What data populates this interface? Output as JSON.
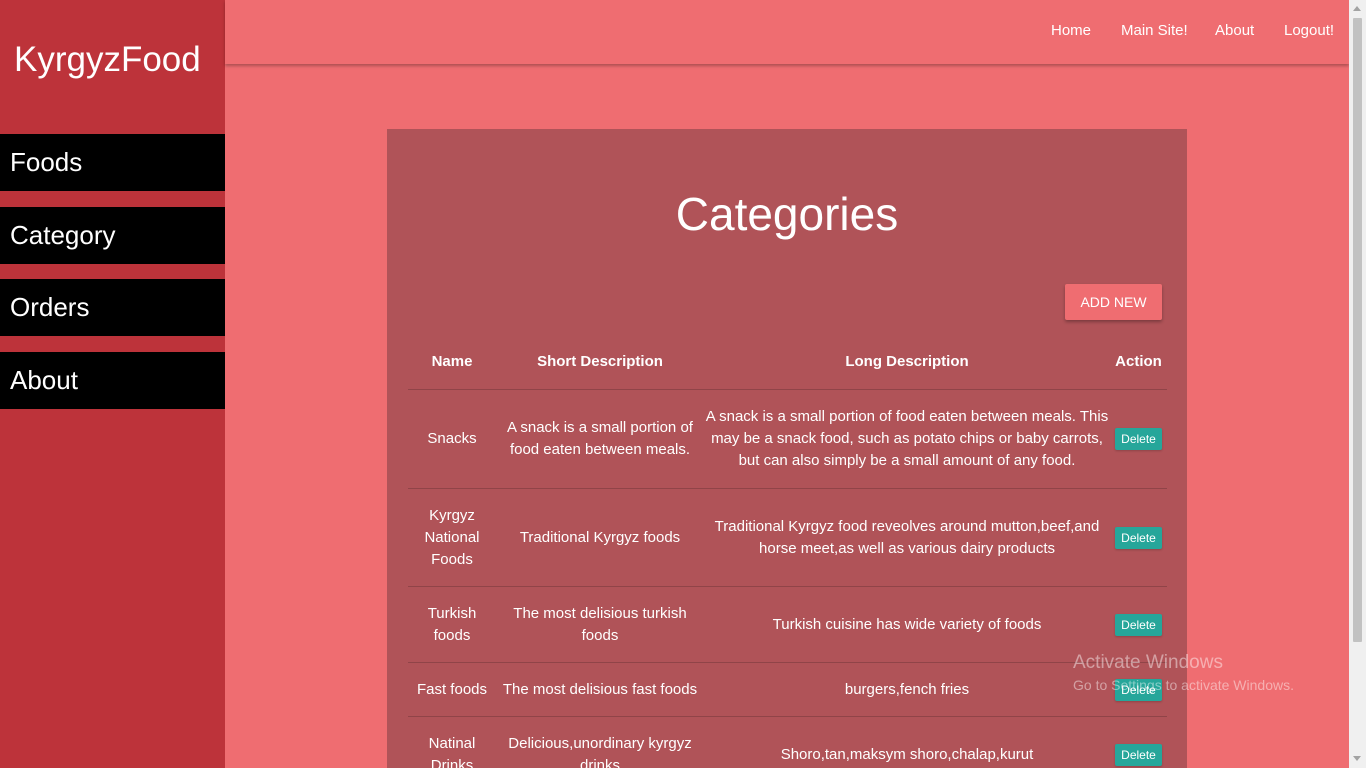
{
  "sidebar": {
    "brand": "KyrgyzFood",
    "items": [
      {
        "label": "Foods"
      },
      {
        "label": "Category"
      },
      {
        "label": "Orders"
      },
      {
        "label": "About"
      }
    ]
  },
  "topnav": {
    "links": [
      {
        "label": "Home"
      },
      {
        "label": "Main Site!"
      },
      {
        "label": "About"
      },
      {
        "label": "Logout!"
      }
    ]
  },
  "main": {
    "title": "Categories",
    "add_button": "ADD NEW",
    "table": {
      "headers": [
        "Name",
        "Short Description",
        "Long Description",
        "Action"
      ],
      "rows": [
        {
          "name": "Snacks",
          "short": "A snack is a small portion of food eaten between meals.",
          "long": "A snack is a small portion of food eaten between meals. This may be a snack food, such as potato chips or baby carrots, but can also simply be a small amount of any food.",
          "action": "Delete"
        },
        {
          "name": "Kyrgyz National Foods",
          "short": "Traditional Kyrgyz foods",
          "long": "Traditional Kyrgyz food reveolves around mutton,beef,and horse meet,as well as various dairy products",
          "action": "Delete"
        },
        {
          "name": "Turkish foods",
          "short": "The most delisious turkish foods",
          "long": "Turkish cuisine has wide variety of foods",
          "action": "Delete"
        },
        {
          "name": "Fast foods",
          "short": "The most delisious fast foods",
          "long": "burgers,fench fries",
          "action": "Delete"
        },
        {
          "name": "Natinal Drinks",
          "short": "Delicious,unordinary kyrgyz drinks",
          "long": "Shoro,tan,maksym shoro,chalap,kurut",
          "action": "Delete"
        }
      ]
    }
  },
  "watermark": {
    "title": "Activate Windows",
    "subtitle": "Go to Settings to activate Windows."
  },
  "colors": {
    "page_bg": "#ef6d71",
    "sidebar_bg": "#bd333a",
    "card_bg": "#b05358",
    "delete_button": "#26a69a"
  }
}
